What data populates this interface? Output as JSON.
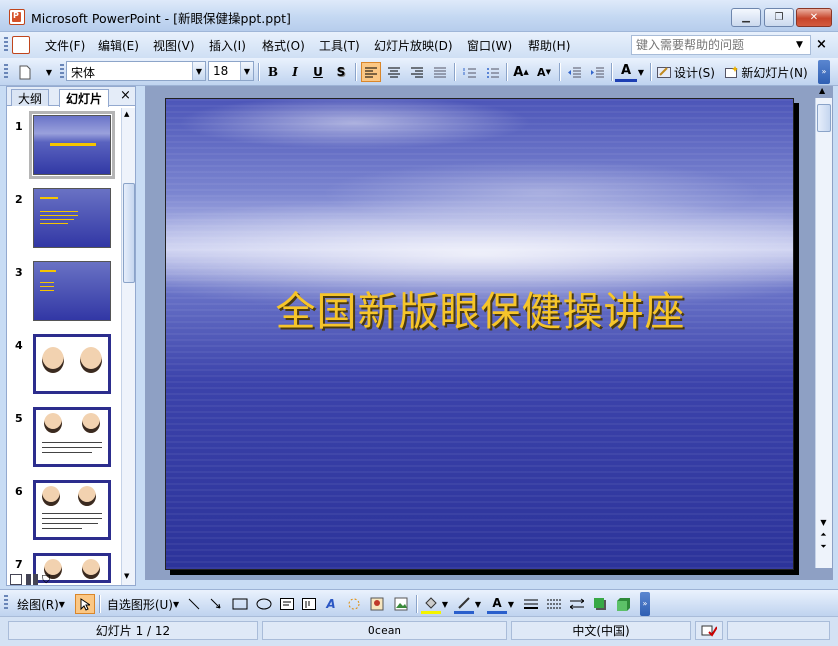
{
  "window": {
    "title": "Microsoft PowerPoint - [新眼保健操ppt.ppt]",
    "minimize": "▁",
    "restore": "❐",
    "close": "✕"
  },
  "menubar": {
    "items": [
      "文件(F)",
      "编辑(E)",
      "视图(V)",
      "插入(I)",
      "格式(O)",
      "工具(T)",
      "幻灯片放映(D)",
      "窗口(W)",
      "帮助(H)"
    ],
    "help_placeholder": "键入需要帮助的问题"
  },
  "toolbar": {
    "font": "宋体",
    "font_size": "18",
    "bold": "B",
    "italic": "I",
    "underline": "U",
    "shadow": "S",
    "design": "设计(S)",
    "new_slide": "新幻灯片(N)"
  },
  "pane": {
    "tab_outline": "大纲",
    "tab_slides": "幻灯片",
    "close": "×",
    "slide_numbers": [
      "1",
      "2",
      "3",
      "4",
      "5",
      "6",
      "7"
    ]
  },
  "slide": {
    "title": "全国新版眼保健操讲座"
  },
  "drawbar": {
    "draw": "绘图(R)",
    "autoshapes": "自选图形(U)"
  },
  "status": {
    "slide": "幻灯片 1 / 12",
    "design": "Ocean",
    "language": "中文(中国)"
  },
  "colors": {
    "accent": "#fbc784",
    "title_text": "#f6c52a",
    "slide_bg": "#3c43ab"
  }
}
